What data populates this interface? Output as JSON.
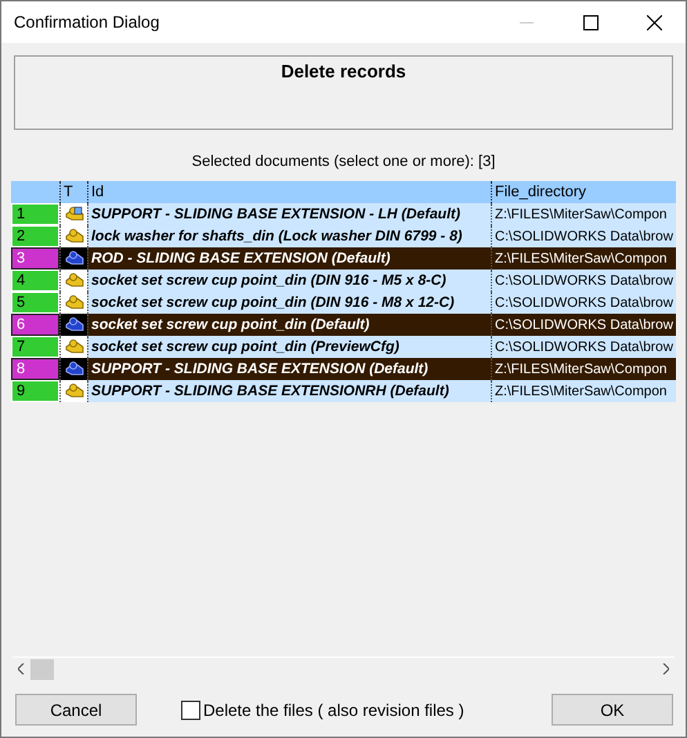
{
  "window": {
    "title": "Confirmation Dialog"
  },
  "header": {
    "title": "Delete records"
  },
  "selection_label": "Selected documents (select one or more): [3]",
  "table": {
    "columns": [
      "T",
      "Id",
      "File_directory"
    ],
    "rows": [
      {
        "number": "1",
        "kind": "assembly",
        "selected": false,
        "id": "SUPPORT - SLIDING BASE EXTENSION - LH (Default)",
        "directory": "Z:\\FILES\\MiterSaw\\Compon"
      },
      {
        "number": "2",
        "kind": "part",
        "selected": false,
        "id": "lock washer for shafts_din (Lock washer DIN 6799 - 8)",
        "directory": "C:\\SOLIDWORKS Data\\brow"
      },
      {
        "number": "3",
        "kind": "part",
        "selected": true,
        "id": "ROD - SLIDING BASE EXTENSION (Default)",
        "directory": "Z:\\FILES\\MiterSaw\\Compon"
      },
      {
        "number": "4",
        "kind": "part",
        "selected": false,
        "id": "socket set screw cup point_din (DIN 916 - M5 x 8-C)",
        "directory": "C:\\SOLIDWORKS Data\\brow"
      },
      {
        "number": "5",
        "kind": "part",
        "selected": false,
        "id": "socket set screw cup point_din (DIN 916 - M8 x 12-C)",
        "directory": "C:\\SOLIDWORKS Data\\brow"
      },
      {
        "number": "6",
        "kind": "part",
        "selected": true,
        "id": "socket set screw cup point_din (Default)",
        "directory": "C:\\SOLIDWORKS Data\\brow"
      },
      {
        "number": "7",
        "kind": "part",
        "selected": false,
        "id": "socket set screw cup point_din (PreviewCfg)",
        "directory": "C:\\SOLIDWORKS Data\\brow"
      },
      {
        "number": "8",
        "kind": "part",
        "selected": true,
        "id": "SUPPORT - SLIDING BASE EXTENSION (Default)",
        "directory": "Z:\\FILES\\MiterSaw\\Compon"
      },
      {
        "number": "9",
        "kind": "part",
        "selected": false,
        "id": "SUPPORT - SLIDING BASE EXTENSIONRH (Default)",
        "directory": "Z:\\FILES\\MiterSaw\\Compon"
      }
    ]
  },
  "delete_files": {
    "label": "Delete the files ( also revision files )",
    "checked": false
  },
  "buttons": [
    "Cancel",
    "OK"
  ]
}
